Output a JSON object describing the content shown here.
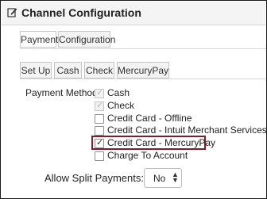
{
  "header": {
    "title": "Channel Configuration",
    "icon": "edit-note-icon"
  },
  "tabs_primary": [
    {
      "label": "Payment",
      "active": true
    },
    {
      "label": "Configuration",
      "active": false
    }
  ],
  "tabs_secondary": [
    {
      "label": "Set Up"
    },
    {
      "label": "Cash"
    },
    {
      "label": "Check"
    },
    {
      "label": "MercuryPay"
    }
  ],
  "payment_methods": {
    "label": "Payment Methods:",
    "options": [
      {
        "label": "Cash",
        "checked": true,
        "disabled": true
      },
      {
        "label": "Check",
        "checked": true,
        "disabled": true
      },
      {
        "label": "Credit Card - Offline",
        "checked": false,
        "disabled": false
      },
      {
        "label": "Credit Card - Intuit Merchant Services",
        "checked": false,
        "disabled": false
      },
      {
        "label": "Credit Card - MercuryPay",
        "checked": true,
        "disabled": false,
        "highlighted": true
      },
      {
        "label": "Charge To Account",
        "checked": false,
        "disabled": false
      }
    ]
  },
  "split_payments": {
    "label": "Allow Split Payments:",
    "value": "No"
  },
  "colors": {
    "highlight_border": "#7a1f2b",
    "header_bg": "#f4f4f4"
  }
}
